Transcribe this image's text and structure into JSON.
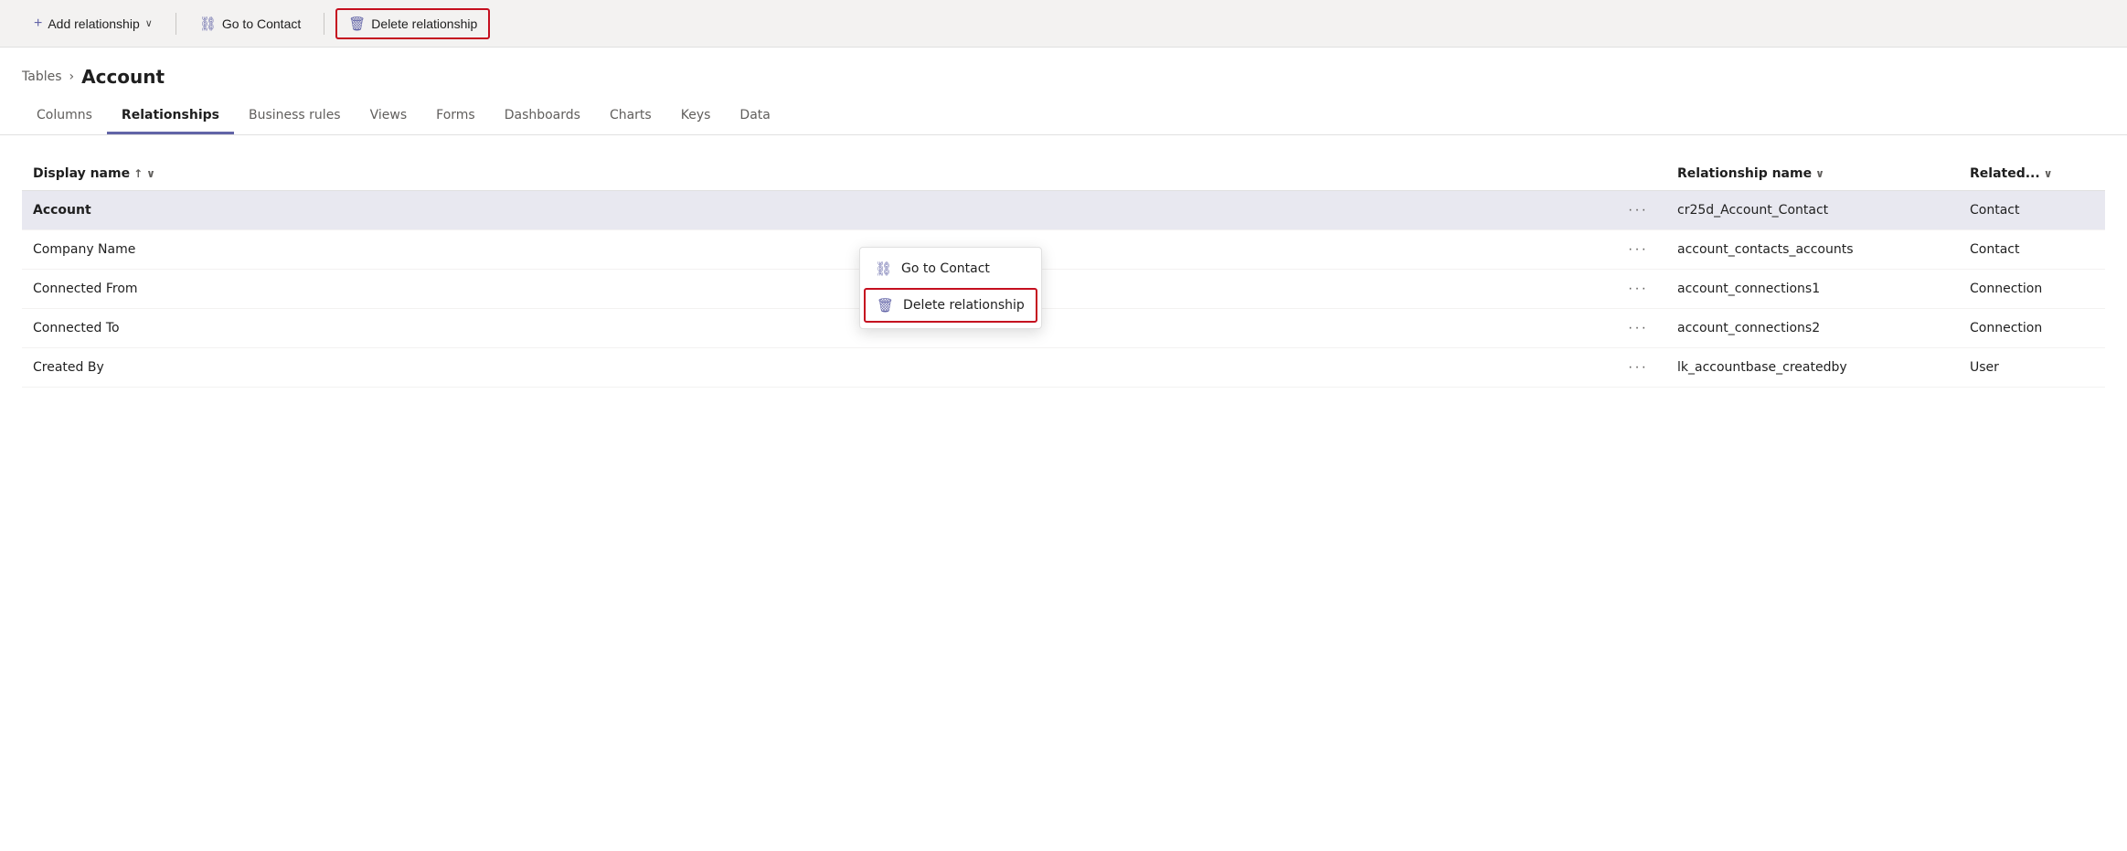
{
  "toolbar": {
    "add_relationship_label": "Add relationship",
    "go_to_contact_label": "Go to Contact",
    "delete_relationship_label": "Delete relationship"
  },
  "breadcrumb": {
    "tables_label": "Tables",
    "separator": "›",
    "current_label": "Account"
  },
  "tabs": [
    {
      "id": "columns",
      "label": "Columns",
      "active": false
    },
    {
      "id": "relationships",
      "label": "Relationships",
      "active": true
    },
    {
      "id": "business_rules",
      "label": "Business rules",
      "active": false
    },
    {
      "id": "views",
      "label": "Views",
      "active": false
    },
    {
      "id": "forms",
      "label": "Forms",
      "active": false
    },
    {
      "id": "dashboards",
      "label": "Dashboards",
      "active": false
    },
    {
      "id": "charts",
      "label": "Charts",
      "active": false
    },
    {
      "id": "keys",
      "label": "Keys",
      "active": false
    },
    {
      "id": "data",
      "label": "Data",
      "active": false
    }
  ],
  "table": {
    "col_display_name": "Display name",
    "col_relationship_name": "Relationship name",
    "col_related": "Related...",
    "rows": [
      {
        "display_name": "Account",
        "dots": "···",
        "relationship_name": "cr25d_Account_Contact",
        "related": "Contact",
        "selected": true
      },
      {
        "display_name": "Company Name",
        "dots": "···",
        "relationship_name": "account_contacts_accounts",
        "related": "Contact",
        "selected": false
      },
      {
        "display_name": "Connected From",
        "dots": "···",
        "relationship_name": "account_connections1",
        "related": "Connection",
        "selected": false
      },
      {
        "display_name": "Connected To",
        "dots": "···",
        "relationship_name": "account_connections2",
        "related": "Connection",
        "selected": false
      },
      {
        "display_name": "Created By",
        "dots": "···",
        "relationship_name": "lk_accountbase_createdby",
        "related": "User",
        "selected": false
      }
    ]
  },
  "context_menu": {
    "go_to_contact_label": "Go to Contact",
    "delete_relationship_label": "Delete relationship"
  },
  "icons": {
    "plus": "+",
    "link": "⛓",
    "trash": "🗑",
    "chevron_down": "∨",
    "arrow_up": "↑",
    "sort_down": "∨"
  }
}
